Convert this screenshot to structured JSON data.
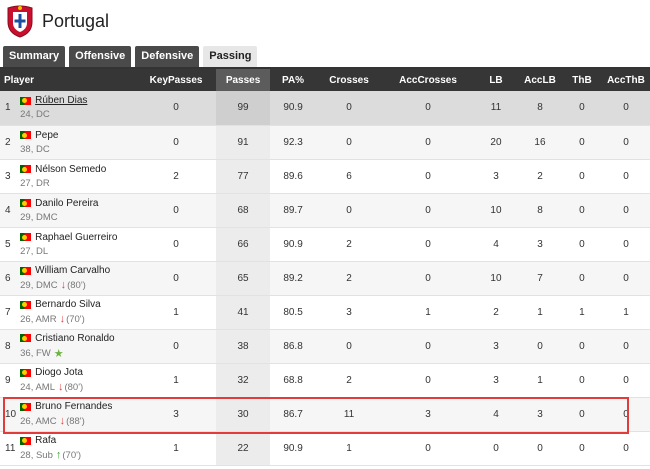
{
  "header": {
    "team_name": "Portugal",
    "crest_icon": "portugal-crest-icon"
  },
  "tabs": [
    {
      "label": "Summary",
      "active": false
    },
    {
      "label": "Offensive",
      "active": false
    },
    {
      "label": "Defensive",
      "active": false
    },
    {
      "label": "Passing",
      "active": true
    }
  ],
  "columns": [
    "Player",
    "KeyPasses",
    "Passes",
    "PA%",
    "Crosses",
    "AccCrosses",
    "LB",
    "AccLB",
    "ThB",
    "AccThB"
  ],
  "sorted_column": "Passes",
  "rows": [
    {
      "idx": "1",
      "name": "Rúben Dias",
      "meta": "24, DC",
      "sub": "",
      "sub_min": "",
      "keypasses": "0",
      "passes": "99",
      "pa": "90.9",
      "crosses": "0",
      "acccrosses": "0",
      "lb": "11",
      "acclb": "8",
      "thb": "0",
      "accthb": "0"
    },
    {
      "idx": "2",
      "name": "Pepe",
      "meta": "38, DC",
      "sub": "",
      "sub_min": "",
      "keypasses": "0",
      "passes": "91",
      "pa": "92.3",
      "crosses": "0",
      "acccrosses": "0",
      "lb": "20",
      "acclb": "16",
      "thb": "0",
      "accthb": "0"
    },
    {
      "idx": "3",
      "name": "Nélson Semedo",
      "meta": "27, DR",
      "sub": "",
      "sub_min": "",
      "keypasses": "2",
      "passes": "77",
      "pa": "89.6",
      "crosses": "6",
      "acccrosses": "0",
      "lb": "3",
      "acclb": "2",
      "thb": "0",
      "accthb": "0"
    },
    {
      "idx": "4",
      "name": "Danilo Pereira",
      "meta": "29, DMC",
      "sub": "",
      "sub_min": "",
      "keypasses": "0",
      "passes": "68",
      "pa": "89.7",
      "crosses": "0",
      "acccrosses": "0",
      "lb": "10",
      "acclb": "8",
      "thb": "0",
      "accthb": "0"
    },
    {
      "idx": "5",
      "name": "Raphael Guerreiro",
      "meta": "27, DL",
      "sub": "",
      "sub_min": "",
      "keypasses": "0",
      "passes": "66",
      "pa": "90.9",
      "crosses": "2",
      "acccrosses": "0",
      "lb": "4",
      "acclb": "3",
      "thb": "0",
      "accthb": "0"
    },
    {
      "idx": "6",
      "name": "William Carvalho",
      "meta": "29, DMC",
      "sub": "down",
      "sub_min": "(80')",
      "keypasses": "0",
      "passes": "65",
      "pa": "89.2",
      "crosses": "2",
      "acccrosses": "0",
      "lb": "10",
      "acclb": "7",
      "thb": "0",
      "accthb": "0"
    },
    {
      "idx": "7",
      "name": "Bernardo Silva",
      "meta": "26, AMR",
      "sub": "down",
      "sub_min": "(70')",
      "keypasses": "1",
      "passes": "41",
      "pa": "80.5",
      "crosses": "3",
      "acccrosses": "1",
      "lb": "2",
      "acclb": "1",
      "thb": "1",
      "accthb": "1"
    },
    {
      "idx": "8",
      "name": "Cristiano Ronaldo",
      "meta": "36, FW",
      "sub": "star",
      "sub_min": "",
      "keypasses": "0",
      "passes": "38",
      "pa": "86.8",
      "crosses": "0",
      "acccrosses": "0",
      "lb": "3",
      "acclb": "0",
      "thb": "0",
      "accthb": "0"
    },
    {
      "idx": "9",
      "name": "Diogo Jota",
      "meta": "24, AML",
      "sub": "down",
      "sub_min": "(80')",
      "keypasses": "1",
      "passes": "32",
      "pa": "68.8",
      "crosses": "2",
      "acccrosses": "0",
      "lb": "3",
      "acclb": "1",
      "thb": "0",
      "accthb": "0"
    },
    {
      "idx": "10",
      "name": "Bruno Fernandes",
      "meta": "26, AMC",
      "sub": "down",
      "sub_min": "(88')",
      "keypasses": "3",
      "passes": "30",
      "pa": "86.7",
      "crosses": "11",
      "acccrosses": "3",
      "lb": "4",
      "acclb": "3",
      "thb": "0",
      "accthb": "0"
    },
    {
      "idx": "11",
      "name": "Rafa",
      "meta": "28, Sub",
      "sub": "up",
      "sub_min": "(70')",
      "keypasses": "1",
      "passes": "22",
      "pa": "90.9",
      "crosses": "1",
      "acccrosses": "0",
      "lb": "0",
      "acclb": "0",
      "thb": "0",
      "accthb": "0"
    }
  ],
  "colors": {
    "header_bg": "#363636",
    "sorted_bg": "#5c5c5c",
    "highlight": "#e23b3b",
    "sub_off": "#e04040",
    "sub_on": "#3aa63a"
  }
}
